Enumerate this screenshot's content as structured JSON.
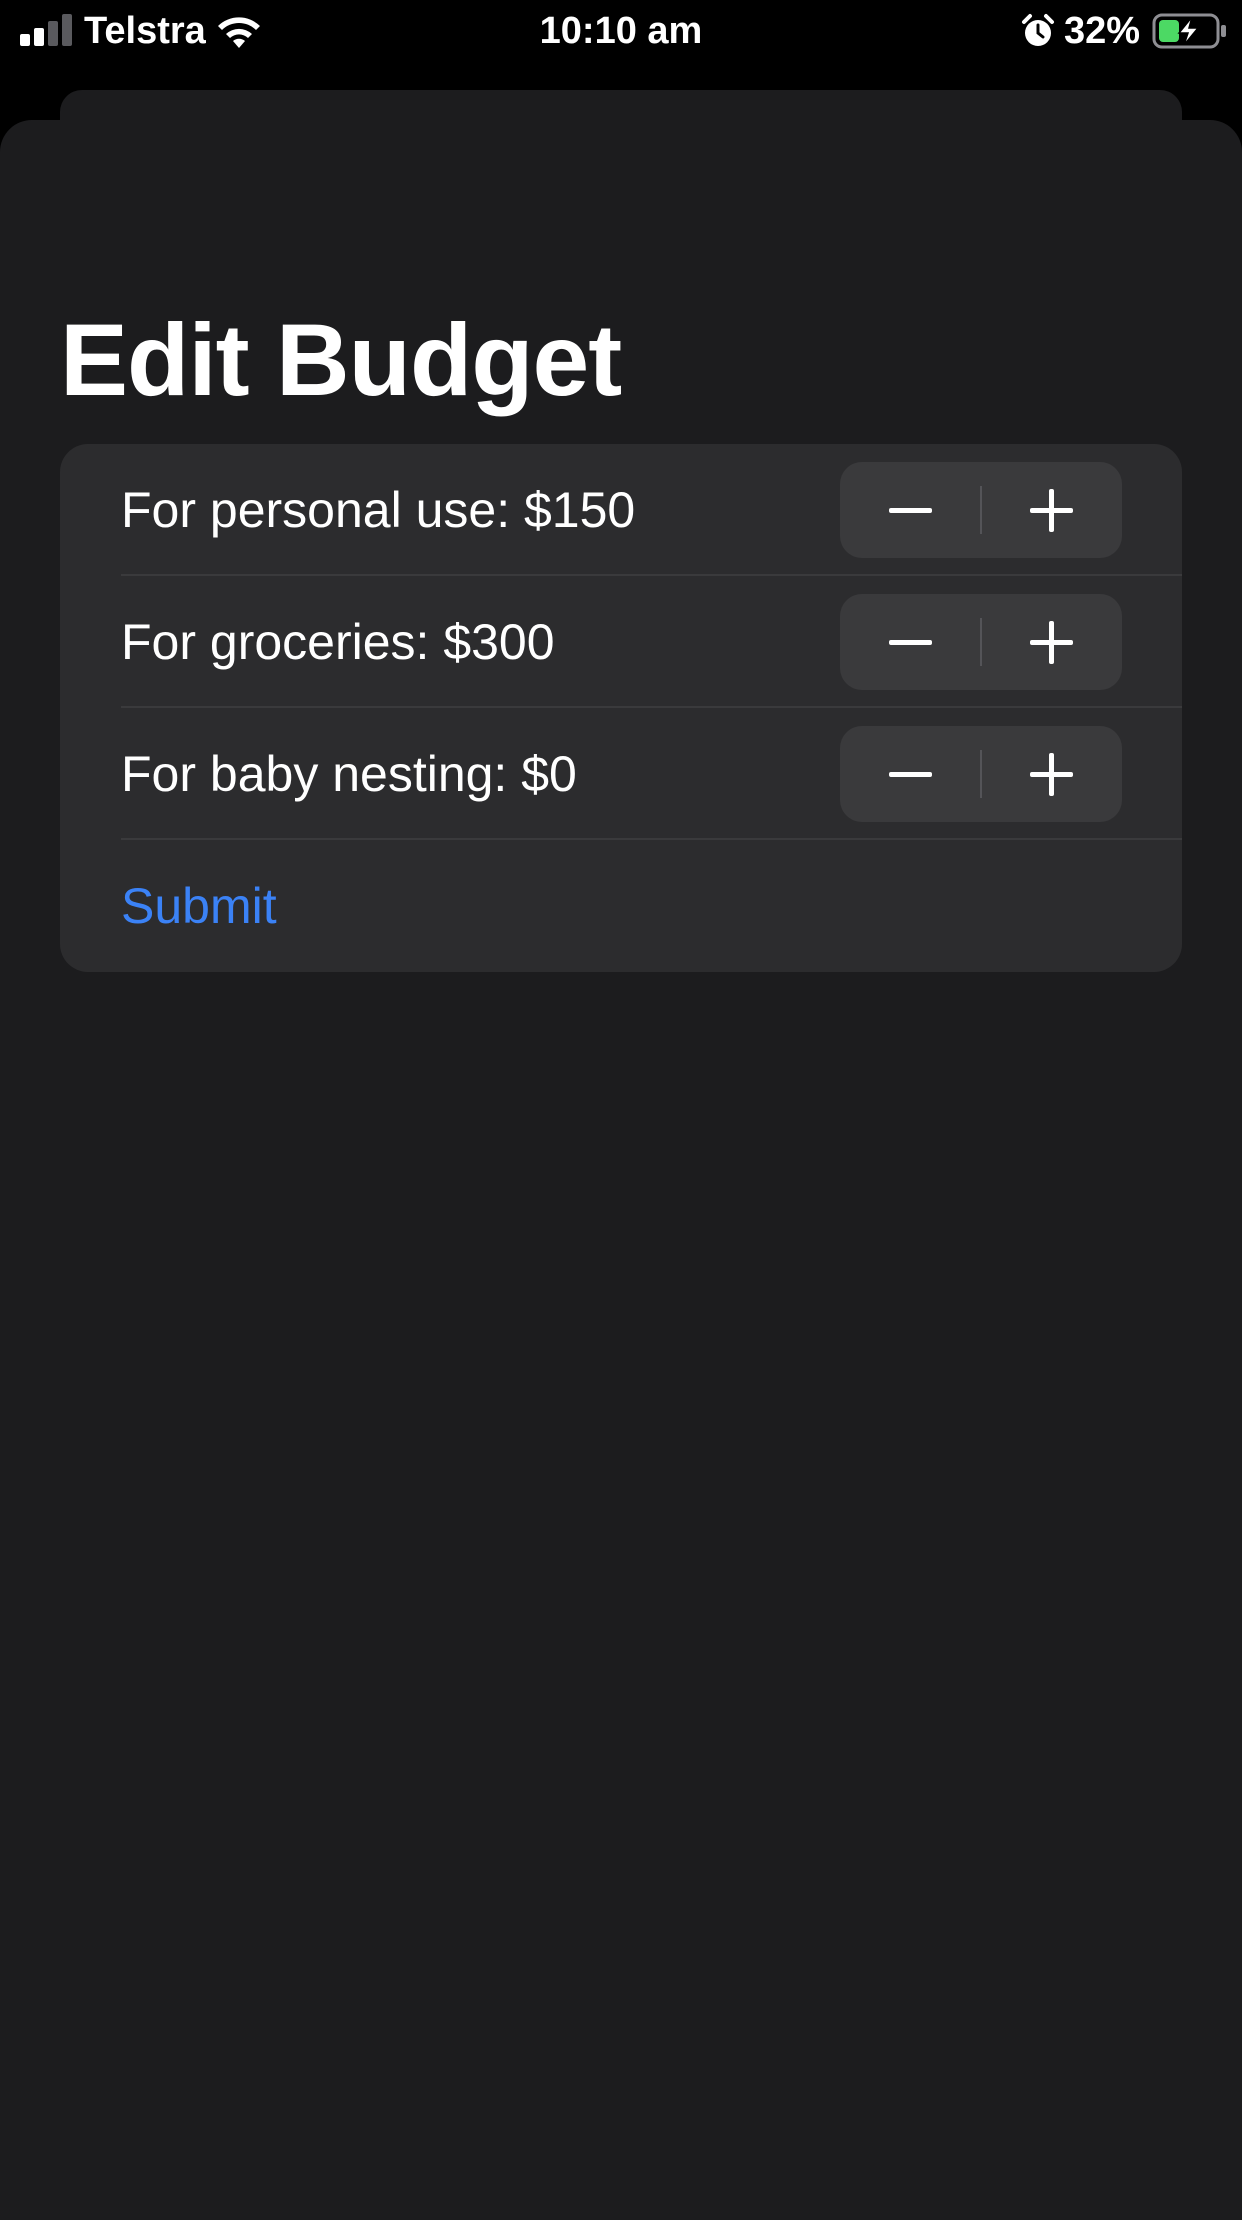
{
  "status_bar": {
    "carrier": "Telstra",
    "time": "10:10 am",
    "battery_percent": "32%",
    "icons": [
      "signal-icon",
      "wifi-icon",
      "alarm-icon",
      "battery-charging-icon"
    ]
  },
  "page": {
    "title": "Edit Budget"
  },
  "budget_items": [
    {
      "label": "For personal use: $150",
      "decrement_icon": "minus-icon",
      "increment_icon": "plus-icon"
    },
    {
      "label": "For groceries: $300",
      "decrement_icon": "minus-icon",
      "increment_icon": "plus-icon"
    },
    {
      "label": "For baby nesting: $0",
      "decrement_icon": "minus-icon",
      "increment_icon": "plus-icon"
    }
  ],
  "form": {
    "submit_label": "Submit"
  },
  "colors": {
    "background": "#1c1c1e",
    "card": "#2c2c2e",
    "stepper": "#3a3a3c",
    "accent": "#3b82f6",
    "battery_fill": "#4cd964"
  }
}
